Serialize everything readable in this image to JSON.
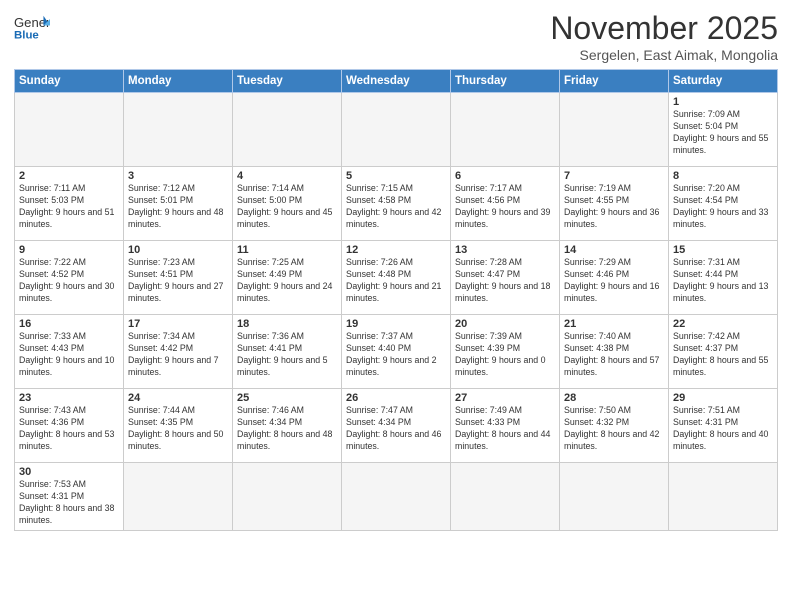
{
  "logo": {
    "text_general": "General",
    "text_blue": "Blue"
  },
  "header": {
    "month_title": "November 2025",
    "subtitle": "Sergelen, East Aimak, Mongolia"
  },
  "weekdays": [
    "Sunday",
    "Monday",
    "Tuesday",
    "Wednesday",
    "Thursday",
    "Friday",
    "Saturday"
  ],
  "weeks": [
    [
      {
        "day": null
      },
      {
        "day": null
      },
      {
        "day": null
      },
      {
        "day": null
      },
      {
        "day": null
      },
      {
        "day": null
      },
      {
        "day": "1",
        "sunrise": "7:09 AM",
        "sunset": "5:04 PM",
        "daylight": "9 hours and 55 minutes."
      }
    ],
    [
      {
        "day": "2",
        "sunrise": "7:11 AM",
        "sunset": "5:03 PM",
        "daylight": "9 hours and 51 minutes."
      },
      {
        "day": "3",
        "sunrise": "7:12 AM",
        "sunset": "5:01 PM",
        "daylight": "9 hours and 48 minutes."
      },
      {
        "day": "4",
        "sunrise": "7:14 AM",
        "sunset": "5:00 PM",
        "daylight": "9 hours and 45 minutes."
      },
      {
        "day": "5",
        "sunrise": "7:15 AM",
        "sunset": "4:58 PM",
        "daylight": "9 hours and 42 minutes."
      },
      {
        "day": "6",
        "sunrise": "7:17 AM",
        "sunset": "4:56 PM",
        "daylight": "9 hours and 39 minutes."
      },
      {
        "day": "7",
        "sunrise": "7:19 AM",
        "sunset": "4:55 PM",
        "daylight": "9 hours and 36 minutes."
      },
      {
        "day": "8",
        "sunrise": "7:20 AM",
        "sunset": "4:54 PM",
        "daylight": "9 hours and 33 minutes."
      }
    ],
    [
      {
        "day": "9",
        "sunrise": "7:22 AM",
        "sunset": "4:52 PM",
        "daylight": "9 hours and 30 minutes."
      },
      {
        "day": "10",
        "sunrise": "7:23 AM",
        "sunset": "4:51 PM",
        "daylight": "9 hours and 27 minutes."
      },
      {
        "day": "11",
        "sunrise": "7:25 AM",
        "sunset": "4:49 PM",
        "daylight": "9 hours and 24 minutes."
      },
      {
        "day": "12",
        "sunrise": "7:26 AM",
        "sunset": "4:48 PM",
        "daylight": "9 hours and 21 minutes."
      },
      {
        "day": "13",
        "sunrise": "7:28 AM",
        "sunset": "4:47 PM",
        "daylight": "9 hours and 18 minutes."
      },
      {
        "day": "14",
        "sunrise": "7:29 AM",
        "sunset": "4:46 PM",
        "daylight": "9 hours and 16 minutes."
      },
      {
        "day": "15",
        "sunrise": "7:31 AM",
        "sunset": "4:44 PM",
        "daylight": "9 hours and 13 minutes."
      }
    ],
    [
      {
        "day": "16",
        "sunrise": "7:33 AM",
        "sunset": "4:43 PM",
        "daylight": "9 hours and 10 minutes."
      },
      {
        "day": "17",
        "sunrise": "7:34 AM",
        "sunset": "4:42 PM",
        "daylight": "9 hours and 7 minutes."
      },
      {
        "day": "18",
        "sunrise": "7:36 AM",
        "sunset": "4:41 PM",
        "daylight": "9 hours and 5 minutes."
      },
      {
        "day": "19",
        "sunrise": "7:37 AM",
        "sunset": "4:40 PM",
        "daylight": "9 hours and 2 minutes."
      },
      {
        "day": "20",
        "sunrise": "7:39 AM",
        "sunset": "4:39 PM",
        "daylight": "9 hours and 0 minutes."
      },
      {
        "day": "21",
        "sunrise": "7:40 AM",
        "sunset": "4:38 PM",
        "daylight": "8 hours and 57 minutes."
      },
      {
        "day": "22",
        "sunrise": "7:42 AM",
        "sunset": "4:37 PM",
        "daylight": "8 hours and 55 minutes."
      }
    ],
    [
      {
        "day": "23",
        "sunrise": "7:43 AM",
        "sunset": "4:36 PM",
        "daylight": "8 hours and 53 minutes."
      },
      {
        "day": "24",
        "sunrise": "7:44 AM",
        "sunset": "4:35 PM",
        "daylight": "8 hours and 50 minutes."
      },
      {
        "day": "25",
        "sunrise": "7:46 AM",
        "sunset": "4:34 PM",
        "daylight": "8 hours and 48 minutes."
      },
      {
        "day": "26",
        "sunrise": "7:47 AM",
        "sunset": "4:34 PM",
        "daylight": "8 hours and 46 minutes."
      },
      {
        "day": "27",
        "sunrise": "7:49 AM",
        "sunset": "4:33 PM",
        "daylight": "8 hours and 44 minutes."
      },
      {
        "day": "28",
        "sunrise": "7:50 AM",
        "sunset": "4:32 PM",
        "daylight": "8 hours and 42 minutes."
      },
      {
        "day": "29",
        "sunrise": "7:51 AM",
        "sunset": "4:31 PM",
        "daylight": "8 hours and 40 minutes."
      }
    ],
    [
      {
        "day": "30",
        "sunrise": "7:53 AM",
        "sunset": "4:31 PM",
        "daylight": "8 hours and 38 minutes."
      },
      {
        "day": null
      },
      {
        "day": null
      },
      {
        "day": null
      },
      {
        "day": null
      },
      {
        "day": null
      },
      {
        "day": null
      }
    ]
  ],
  "labels": {
    "sunrise": "Sunrise:",
    "sunset": "Sunset:",
    "daylight": "Daylight:"
  }
}
